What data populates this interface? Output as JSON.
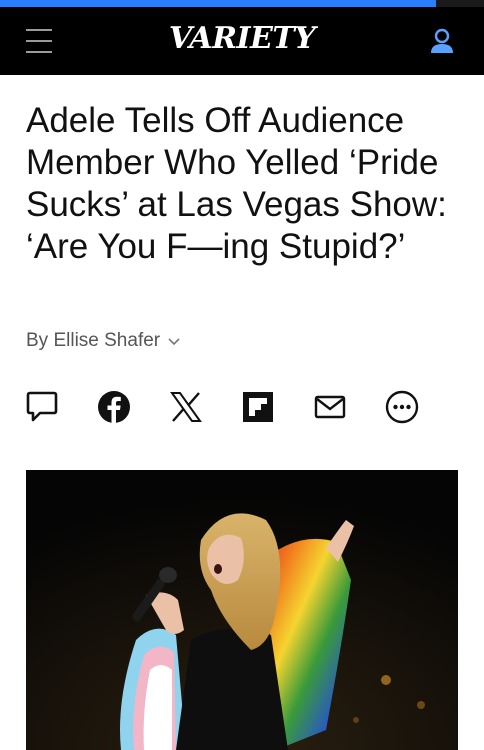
{
  "header": {
    "logo": "VARIETY",
    "menu_icon": "hamburger-menu-icon",
    "account_icon": "user-account-icon",
    "accent_color": "#2a7fff",
    "reading_progress": 0.9
  },
  "article": {
    "headline": "Adele Tells Off Audience Member Who Yelled ‘Pride Sucks’ at Las Vegas Show: ‘Are You F—ing Stupid?’",
    "byline": "By Ellise Shafer"
  },
  "share": [
    {
      "name": "comment",
      "icon": "comment-icon"
    },
    {
      "name": "facebook",
      "icon": "facebook-icon"
    },
    {
      "name": "x",
      "icon": "x-icon"
    },
    {
      "name": "flipboard",
      "icon": "flipboard-icon"
    },
    {
      "name": "email",
      "icon": "email-icon"
    },
    {
      "name": "more",
      "icon": "more-options-icon"
    }
  ]
}
